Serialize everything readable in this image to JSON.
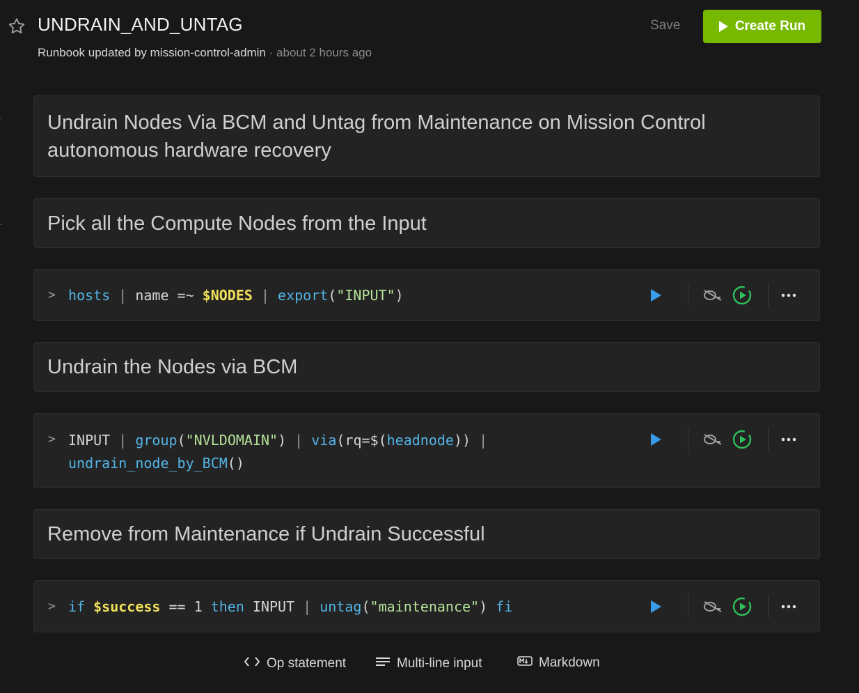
{
  "header": {
    "title": "UNDRAIN_AND_UNTAG",
    "updated_by_prefix": "Runbook updated by",
    "updated_by_user": "mission-control-admin",
    "updated_time": "· about 2 hours ago",
    "save_label": "Save",
    "create_run_label": "Create Run"
  },
  "cells": {
    "title_text": "Undrain Nodes Via BCM and Untag from Maintenance on Mission Control autonomous hardware recovery",
    "md1": "Pick all the Compute Nodes from the Input",
    "code1": [
      {
        "t": "hosts",
        "c": "cmd"
      },
      {
        "t": " | ",
        "c": "pipe"
      },
      {
        "t": "name =~ ",
        "c": "plain"
      },
      {
        "t": "$NODES",
        "c": "var"
      },
      {
        "t": " | ",
        "c": "pipe"
      },
      {
        "t": "export",
        "c": "cmd"
      },
      {
        "t": "(",
        "c": "plain"
      },
      {
        "t": "\"INPUT\"",
        "c": "str"
      },
      {
        "t": ")",
        "c": "plain"
      }
    ],
    "md2": "Undrain the Nodes via BCM",
    "code2_line1": [
      {
        "t": "INPUT",
        "c": "plain"
      },
      {
        "t": " | ",
        "c": "pipe"
      },
      {
        "t": "group",
        "c": "cmd"
      },
      {
        "t": "(",
        "c": "plain"
      },
      {
        "t": "\"NVLDOMAIN\"",
        "c": "str"
      },
      {
        "t": ")",
        "c": "plain"
      },
      {
        "t": " | ",
        "c": "pipe"
      },
      {
        "t": "via",
        "c": "cmd"
      },
      {
        "t": "(rq=$(",
        "c": "plain"
      },
      {
        "t": "headnode",
        "c": "cmd"
      },
      {
        "t": "))",
        "c": "plain"
      },
      {
        "t": " |",
        "c": "pipe"
      }
    ],
    "code2_line2": [
      {
        "t": "undrain_node_by_BCM",
        "c": "cmd"
      },
      {
        "t": "()",
        "c": "plain"
      }
    ],
    "md3": "Remove from Maintenance if Undrain Successful",
    "code3": [
      {
        "t": "if ",
        "c": "cmd"
      },
      {
        "t": "$success",
        "c": "var"
      },
      {
        "t": " == 1 ",
        "c": "plain"
      },
      {
        "t": "then ",
        "c": "cmd"
      },
      {
        "t": "INPUT",
        "c": "plain"
      },
      {
        "t": " | ",
        "c": "pipe"
      },
      {
        "t": "untag",
        "c": "cmd"
      },
      {
        "t": "(",
        "c": "plain"
      },
      {
        "t": "\"maintenance\"",
        "c": "str"
      },
      {
        "t": ") ",
        "c": "plain"
      },
      {
        "t": "fi",
        "c": "cmd"
      }
    ],
    "chevron": ">"
  },
  "footer": {
    "op_statement": "Op statement",
    "multi_line": "Multi-line input",
    "markdown": "Markdown"
  },
  "colors": {
    "accent": "#76b900",
    "run_blue": "#3a9be8",
    "run_all_green": "#2fbf5b",
    "cmd": "#53b4e6",
    "string": "#b5e29a",
    "variable": "#f2e05a"
  },
  "icons": {
    "favorite": "star-icon",
    "run": "play-icon",
    "hide": "eye-off-icon",
    "run_from_here": "play-circle-icon",
    "more": "more-icon",
    "op": "code-brackets-icon",
    "multi": "lines-icon",
    "md": "markdown-icon"
  }
}
